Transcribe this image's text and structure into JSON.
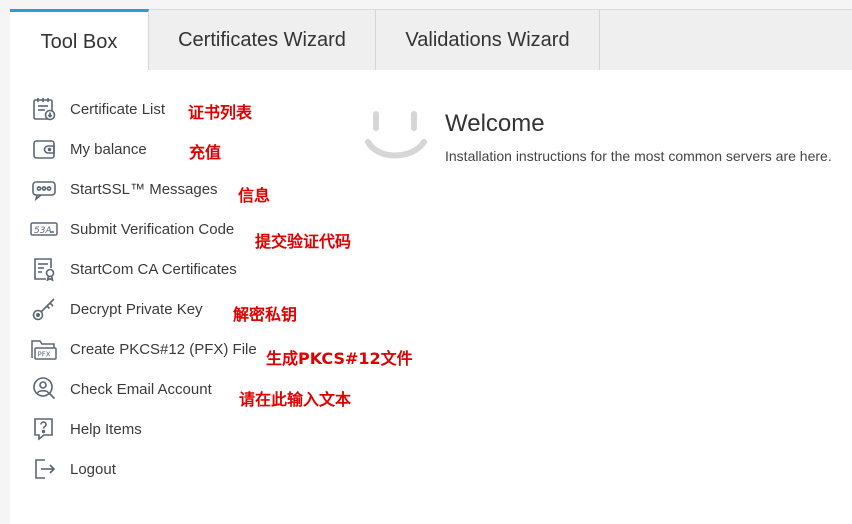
{
  "tabs": [
    {
      "label": "Tool Box",
      "active": true
    },
    {
      "label": "Certificates Wizard",
      "active": false
    },
    {
      "label": "Validations Wizard",
      "active": false
    }
  ],
  "menu": [
    {
      "label": "Certificate List",
      "icon": "certificate-list-icon",
      "note": "证书列表"
    },
    {
      "label": "My balance",
      "icon": "wallet-icon",
      "note": "充值"
    },
    {
      "label": "StartSSL™ Messages",
      "icon": "message-icon",
      "note": "信息"
    },
    {
      "label": "Submit Verification Code",
      "icon": "verification-code-icon",
      "note": "提交验证代码"
    },
    {
      "label": "StartCom CA Certificates",
      "icon": "ca-certificate-icon",
      "note": ""
    },
    {
      "label": "Decrypt Private Key",
      "icon": "key-icon",
      "note": "解密私钥"
    },
    {
      "label": "Create PKCS#12 (PFX) File",
      "icon": "pfx-folder-icon",
      "note": "生成PKCS#12文件"
    },
    {
      "label": "Check Email Account",
      "icon": "email-search-icon",
      "note": "请在此输入文本"
    },
    {
      "label": "Help Items",
      "icon": "help-icon",
      "note": ""
    },
    {
      "label": "Logout",
      "icon": "logout-icon",
      "note": ""
    }
  ],
  "welcome": {
    "title": "Welcome",
    "text": "Installation instructions for the most common servers are here.",
    "icon": "smiley-icon"
  },
  "colors": {
    "accent": "#2e9ad6",
    "annotation": "#e00000",
    "icon": "#5a6675"
  }
}
